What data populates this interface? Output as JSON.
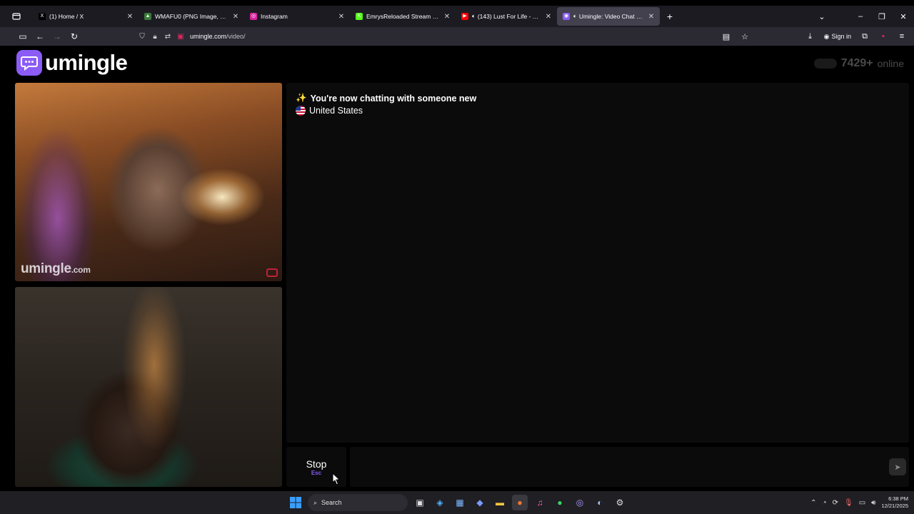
{
  "browser": {
    "tabs": [
      {
        "title": "(1) Home / X",
        "favicon_color": "#000000",
        "glyph": "X",
        "active": false,
        "sound": false
      },
      {
        "title": "WMAFU0 (PNG Image, 873 × 1",
        "favicon_color": "#3a7a3a",
        "glyph": "▲",
        "active": false,
        "sound": false
      },
      {
        "title": "Instagram",
        "favicon_color": "#d6249f",
        "glyph": "◎",
        "active": false,
        "sound": false
      },
      {
        "title": "EmrysReloaded Stream - Watch",
        "favicon_color": "#53fc18",
        "glyph": "K",
        "active": false,
        "sound": false
      },
      {
        "title": "(143) Lust For Life - YouTub",
        "favicon_color": "#ff0000",
        "glyph": "▶",
        "active": false,
        "sound": true
      },
      {
        "title": "Umingle: Video Chat with S",
        "favicon_color": "#8b5cf6",
        "glyph": "◉",
        "active": true,
        "sound": true
      }
    ],
    "url_domain": "umingle.com",
    "url_path": "/video/",
    "sign_in_label": "Sign in"
  },
  "header": {
    "logo_text": "umingle",
    "online_count": "7429+",
    "online_label": "online",
    "accent_color": "#8b5cf6"
  },
  "stranger_video": {
    "watermark_name": "umingle",
    "watermark_domain": ".com"
  },
  "chat": {
    "status_icon": "✨",
    "status_message": "You're now chatting with someone new",
    "country": "United States",
    "input_placeholder": "",
    "stop_label": "Stop",
    "stop_key": "Esc"
  },
  "taskbar": {
    "search_label": "Search",
    "time": "6:38 PM",
    "date": "12/21/2025"
  }
}
